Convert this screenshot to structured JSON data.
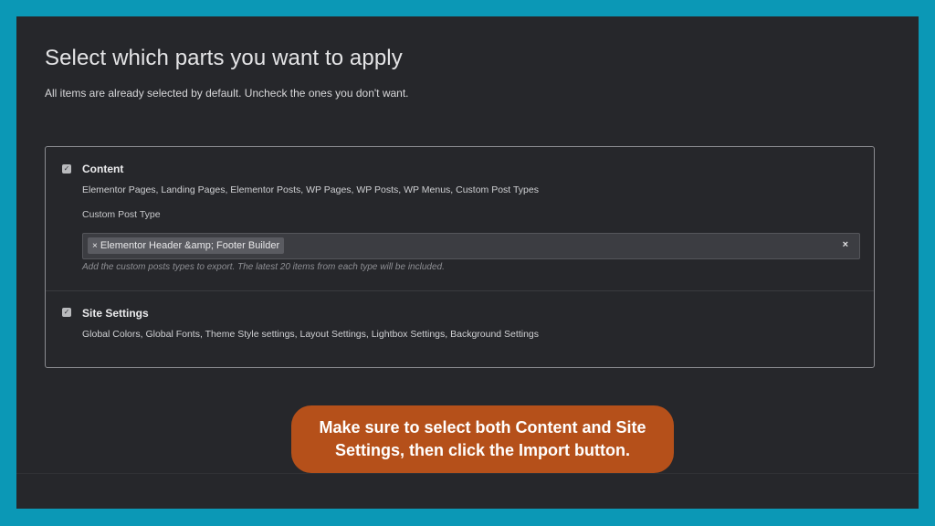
{
  "header": {
    "title": "Select which parts you want to apply",
    "subtitle": "All items are already selected by default. Uncheck the ones you don't want."
  },
  "content_section": {
    "checked": true,
    "title": "Content",
    "description": "Elementor Pages, Landing Pages, Elementor Posts, WP Pages, WP Posts, WP Menus, Custom Post Types",
    "custom_post_type_label": "Custom Post Type",
    "selected_chip": "Elementor Header &amp; Footer Builder",
    "chip_remove_symbol": "×",
    "clear_symbol": "×",
    "help_text": "Add the custom posts types to export. The latest 20 items from each type will be included."
  },
  "site_settings_section": {
    "checked": true,
    "title": "Site Settings",
    "description": "Global Colors, Global Fonts, Theme Style settings, Layout Settings, Lightbox Settings, Background Settings"
  },
  "callout": {
    "text": "Make sure to select both Content and Site Settings, then click the Import button."
  },
  "colors": {
    "frame": "#0b98b6",
    "panel": "#26272b",
    "callout": "#b5501a"
  },
  "icons": {
    "checkbox_check": "check-icon",
    "chip_remove": "close-icon",
    "clear": "close-icon"
  }
}
